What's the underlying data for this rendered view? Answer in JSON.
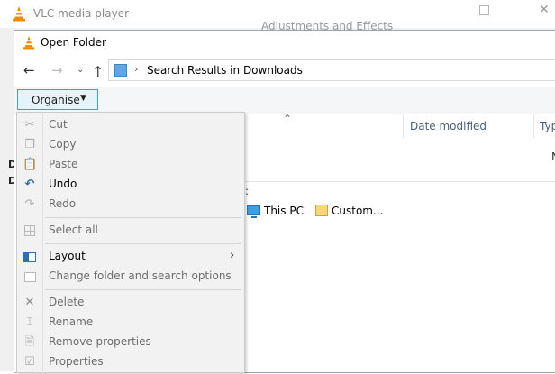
{
  "vlc": {
    "title": "VLC media player",
    "close_glyph": "✕",
    "edge_letters": [
      "D",
      "D"
    ]
  },
  "adjustments": {
    "title": "Adjustments and Effects"
  },
  "dialog": {
    "title": "Open Folder",
    "address": {
      "separator": "›",
      "path": "Search Results in Downloads"
    },
    "nav": {
      "back": "←",
      "forward": "→",
      "recent": "⌄",
      "up": "↑"
    },
    "organise": {
      "label": "Organise",
      "caret": "▼"
    },
    "columns": {
      "sort_caret": "⌃",
      "date_modified": "Date modified",
      "type": "Typ"
    },
    "results_partial": "N",
    "search_again_colon": ":",
    "locations": [
      {
        "label": "This PC",
        "icon": "computer-icon"
      },
      {
        "label": "Custom...",
        "icon": "folder-icon"
      }
    ]
  },
  "organise_menu": {
    "items": [
      {
        "label": "Cut",
        "icon": "scissors-icon",
        "glyph": "✂",
        "enabled": false
      },
      {
        "label": "Copy",
        "icon": "copy-icon",
        "glyph": "❐",
        "enabled": false
      },
      {
        "label": "Paste",
        "icon": "paste-icon",
        "glyph": "📋",
        "enabled": false
      },
      {
        "label": "Undo",
        "icon": "undo-icon",
        "glyph": "↶",
        "enabled": true
      },
      {
        "label": "Redo",
        "icon": "redo-icon",
        "glyph": "↷",
        "enabled": false
      },
      {
        "label": "Select all",
        "icon": "select-all-icon",
        "enabled": false
      },
      {
        "label": "Layout",
        "icon": "layout-icon",
        "enabled": true,
        "submenu_arrow": "›"
      },
      {
        "label": "Change folder and search options",
        "icon": "folder-options-icon",
        "enabled": false
      },
      {
        "label": "Delete",
        "icon": "delete-icon",
        "glyph": "✕",
        "enabled": false
      },
      {
        "label": "Rename",
        "icon": "rename-icon",
        "glyph": "⌶",
        "enabled": false
      },
      {
        "label": "Remove properties",
        "icon": "remove-properties-icon",
        "glyph": "🗎",
        "enabled": false
      },
      {
        "label": "Properties",
        "icon": "properties-icon",
        "glyph": "☑",
        "enabled": false
      }
    ]
  },
  "colors": {
    "accent": "#3c9fd6",
    "organise_bg": "#e5f3fb",
    "menu_bg": "#f2f2f2",
    "disabled_text": "#6d6d6d",
    "vlc_orange": "#f08a00"
  }
}
